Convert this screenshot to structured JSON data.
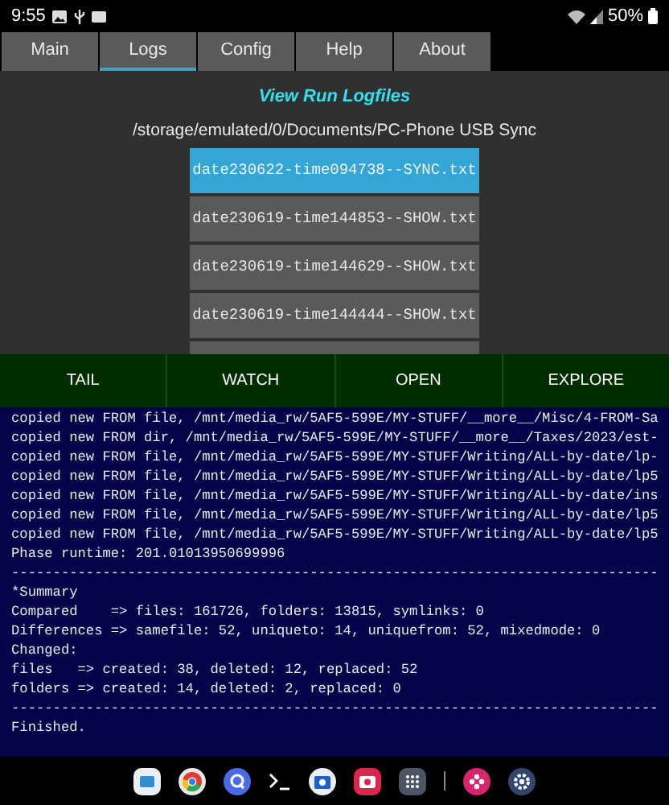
{
  "status_bar": {
    "time": "9:55",
    "battery": "50%"
  },
  "tabs": [
    {
      "label": "Main",
      "selected": false
    },
    {
      "label": "Logs",
      "selected": true
    },
    {
      "label": "Config",
      "selected": false
    },
    {
      "label": "Help",
      "selected": false
    },
    {
      "label": "About",
      "selected": false
    }
  ],
  "heading": "View Run Logfiles",
  "folder_path": "/storage/emulated/0/Documents/PC-Phone USB Sync",
  "files": [
    {
      "name": "date230622-time094738--SYNC.txt",
      "selected": true
    },
    {
      "name": "date230619-time144853--SHOW.txt",
      "selected": false
    },
    {
      "name": "date230619-time144629--SHOW.txt",
      "selected": false
    },
    {
      "name": "date230619-time144444--SHOW.txt",
      "selected": false
    }
  ],
  "actions": [
    "TAIL",
    "WATCH",
    "OPEN",
    "EXPLORE"
  ],
  "log_lines": [
    "copied new FROM file, /mnt/media_rw/5AF5-599E/MY-STUFF/__more__/Misc/4-FROM-Sa",
    "copied new FROM dir, /mnt/media_rw/5AF5-599E/MY-STUFF/__more__/Taxes/2023/est-",
    "copied new FROM file, /mnt/media_rw/5AF5-599E/MY-STUFF/Writing/ALL-by-date/lp-",
    "copied new FROM file, /mnt/media_rw/5AF5-599E/MY-STUFF/Writing/ALL-by-date/lp5",
    "copied new FROM file, /mnt/media_rw/5AF5-599E/MY-STUFF/Writing/ALL-by-date/ins",
    "copied new FROM file, /mnt/media_rw/5AF5-599E/MY-STUFF/Writing/ALL-by-date/lp5",
    "copied new FROM file, /mnt/media_rw/5AF5-599E/MY-STUFF/Writing/ALL-by-date/lp5",
    "Phase runtime: 201.01013950699996",
    "------------------------------------------------------------------------------",
    "*Summary",
    "Compared    => files: 161726, folders: 13815, symlinks: 0",
    "Differences => samefile: 52, uniqueto: 14, uniquefrom: 52, mixedmode: 0",
    "Changed:",
    "files   => created: 38, deleted: 12, replaced: 52",
    "folders => created: 14, deleted: 2, replaced: 0",
    "------------------------------------------------------------------------------",
    "Finished."
  ]
}
